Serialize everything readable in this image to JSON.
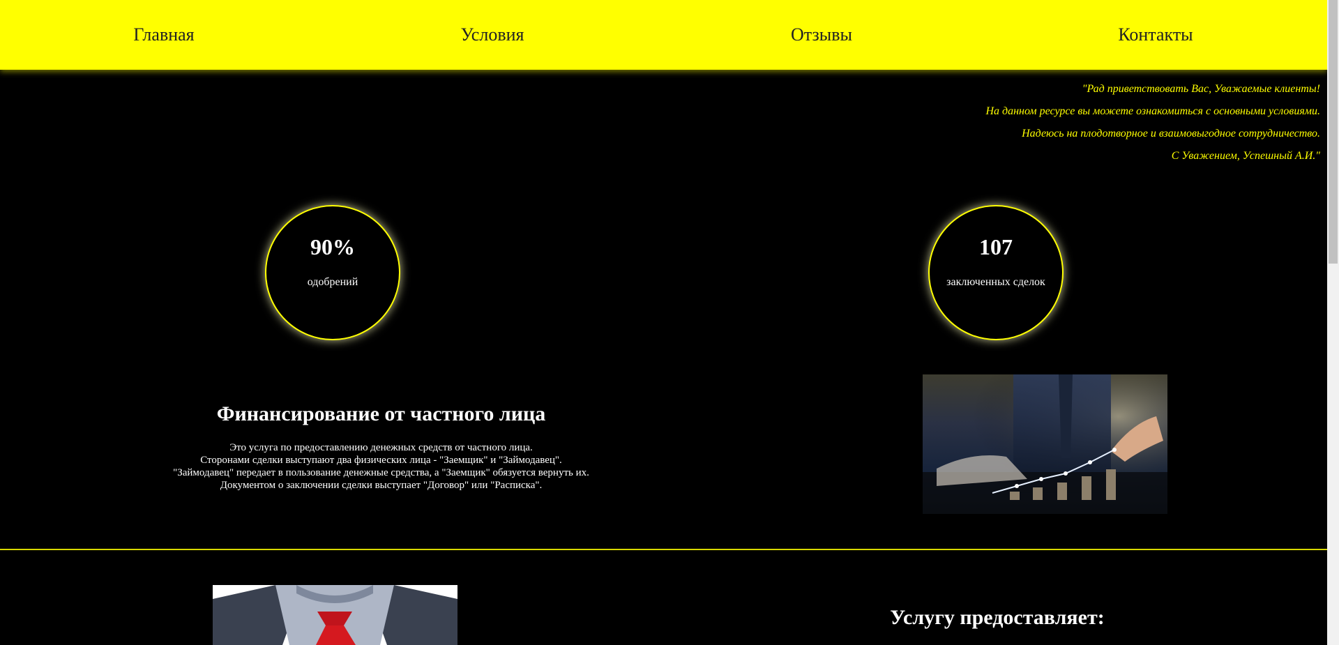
{
  "nav": {
    "items": [
      {
        "label": "Главная"
      },
      {
        "label": "Условия"
      },
      {
        "label": "Отзывы"
      },
      {
        "label": "Контакты"
      }
    ]
  },
  "greeting": {
    "lines": [
      "\"Рад приветствовать Вас, Уважаемые клиенты!",
      "На данном ресурсе вы можете ознакомиться с основными условиями.",
      "Надеюсь на плодотворное и взаимовыгодное сотрудничество.",
      "С Уважением, Успешный А.И.\""
    ]
  },
  "stats": [
    {
      "value": "90%",
      "caption": "одобрений"
    },
    {
      "value": "107",
      "caption": "заключенных сделок"
    }
  ],
  "service": {
    "title": "Финансирование от частного лица",
    "lines": [
      "Это услуга по предоставлению денежных средств от частного лица.",
      "Сторонами сделки выступают два физических лица - \"Заемщик\" и \"Займодавец\".",
      "\"Займодавец\" передает в пользование денежные средства, а \"Заемщик\" обязуется вернуть их.",
      "Документом о заключении сделки выступает \"Договор\" или \"Расписка\"."
    ]
  },
  "provider": {
    "title": "Услугу предоставляет:"
  },
  "colors": {
    "accent": "#ffff00",
    "background": "#000000",
    "text": "#ffffff",
    "nav_text": "#222222"
  }
}
